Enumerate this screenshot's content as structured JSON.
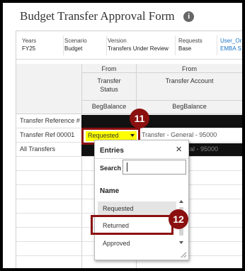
{
  "page": {
    "title": "Budget Transfer Approval Form",
    "info_icon": "i"
  },
  "pov": [
    {
      "label": "Years",
      "value": "FY25"
    },
    {
      "label": "Scenario",
      "value": "Budget"
    },
    {
      "label": "Version",
      "value": "Transfers Under Review"
    },
    {
      "label": "Requests",
      "value": "Base"
    },
    {
      "label": "User_Or",
      "value": "EMBA S"
    }
  ],
  "grid": {
    "columns": [
      {
        "from": "From",
        "header": "Transfer Status",
        "sub": "BegBalance"
      },
      {
        "from": "From",
        "header": "Transfer Account",
        "sub": "BegBalance"
      }
    ],
    "rows": [
      {
        "label": "Transfer Reference #"
      },
      {
        "label": "Transfer Ref 00001",
        "status": "Requested",
        "account": "Transfer - General - 95000"
      },
      {
        "label": "All Transfers",
        "account": "al - 95000"
      }
    ]
  },
  "callouts": {
    "step11": "11",
    "step12": "12"
  },
  "popup": {
    "title": "Entries",
    "close": "×",
    "search_label": "Search",
    "search_value": "",
    "name_header": "Name",
    "entries": [
      "Requested",
      "Returned",
      "Approved"
    ]
  },
  "colors": {
    "highlight": "#ffff00",
    "callout": "#8b1010",
    "link": "#1a73c7"
  }
}
